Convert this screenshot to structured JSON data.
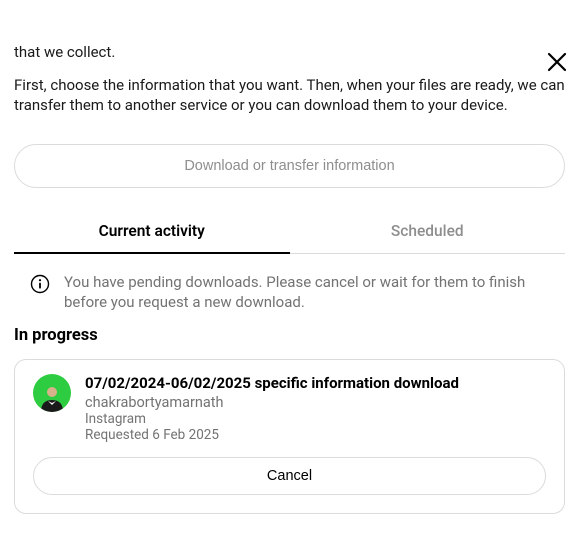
{
  "truncated_text": "that we collect.",
  "intro_text": "First, choose the information that you want. Then, when your files are ready, we can transfer them to another service or you can download them to your device.",
  "download_button": "Download or transfer information",
  "tabs": {
    "current": "Current activity",
    "scheduled": "Scheduled"
  },
  "notice": "You have pending downloads. Please cancel or wait for them to finish before you request a new download.",
  "section_title": "In progress",
  "download_item": {
    "title": "07/02/2024-06/02/2025 specific information download",
    "username": "chakrabortyamarnath",
    "service": "Instagram",
    "requested": "Requested 6 Feb 2025",
    "cancel_label": "Cancel"
  }
}
